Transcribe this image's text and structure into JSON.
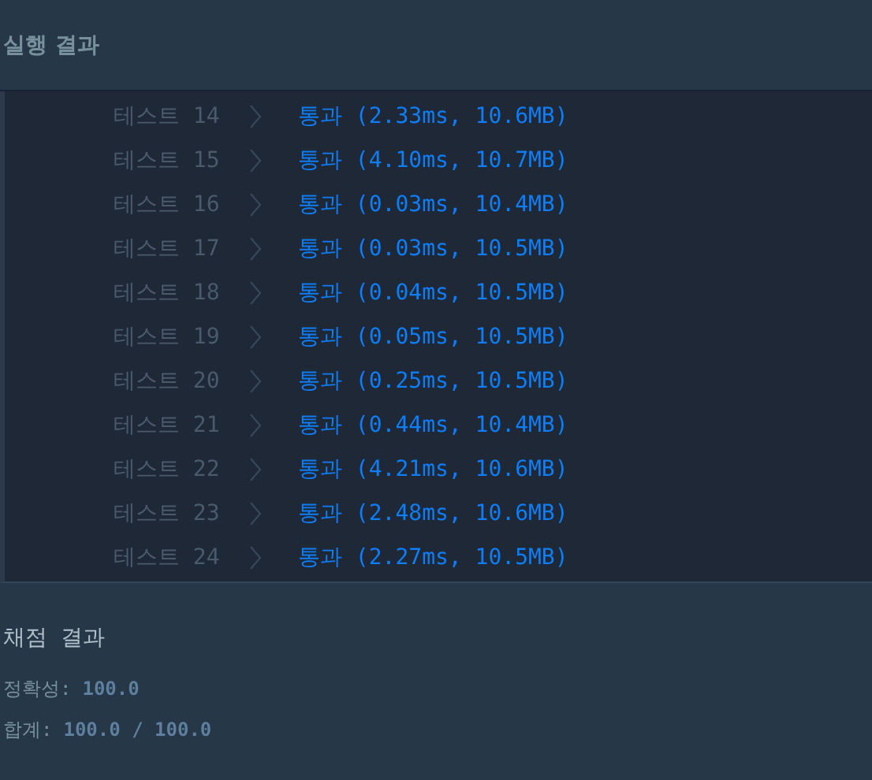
{
  "header": {
    "title": "실행 결과"
  },
  "tests": [
    {
      "label": "테스트 14",
      "result": "통과 (2.33ms, 10.6MB)"
    },
    {
      "label": "테스트 15",
      "result": "통과 (4.10ms, 10.7MB)"
    },
    {
      "label": "테스트 16",
      "result": "통과 (0.03ms, 10.4MB)"
    },
    {
      "label": "테스트 17",
      "result": "통과 (0.03ms, 10.5MB)"
    },
    {
      "label": "테스트 18",
      "result": "통과 (0.04ms, 10.5MB)"
    },
    {
      "label": "테스트 19",
      "result": "통과 (0.05ms, 10.5MB)"
    },
    {
      "label": "테스트 20",
      "result": "통과 (0.25ms, 10.5MB)"
    },
    {
      "label": "테스트 21",
      "result": "통과 (0.44ms, 10.4MB)"
    },
    {
      "label": "테스트 22",
      "result": "통과 (4.21ms, 10.6MB)"
    },
    {
      "label": "테스트 23",
      "result": "통과 (2.48ms, 10.6MB)"
    },
    {
      "label": "테스트 24",
      "result": "통과 (2.27ms, 10.5MB)"
    }
  ],
  "score": {
    "title": "채점 결과",
    "lines": [
      {
        "label": "정확성:",
        "value": "100.0"
      },
      {
        "label": "합계:",
        "value": "100.0 / 100.0"
      }
    ]
  }
}
